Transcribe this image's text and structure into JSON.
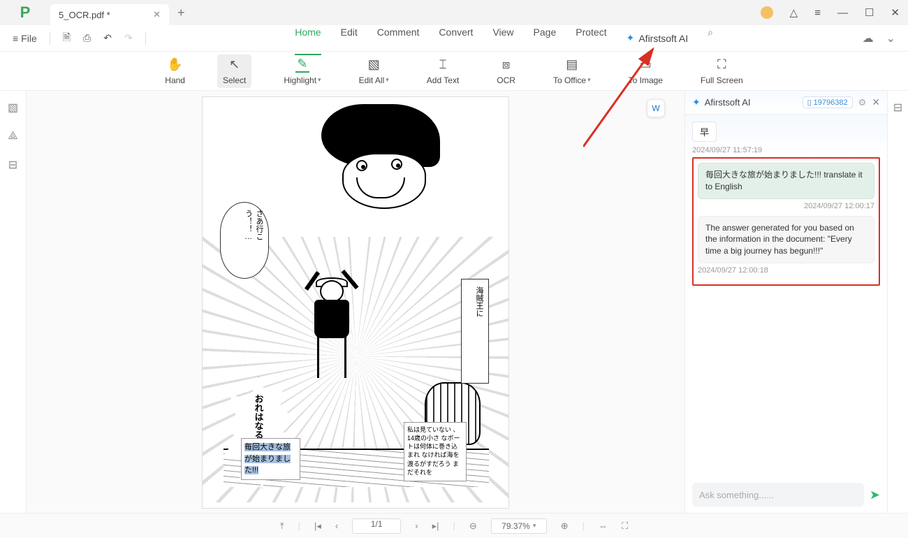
{
  "titlebar": {
    "tab_title": "5_OCR.pdf *"
  },
  "menubar": {
    "file_label": "File",
    "items": [
      "Home",
      "Edit",
      "Comment",
      "Convert",
      "View",
      "Page",
      "Protect"
    ],
    "active": "Home",
    "ai_label": "Afirstsoft AI"
  },
  "toolbar": {
    "hand": "Hand",
    "select": "Select",
    "highlight": "Highlight",
    "edit_all": "Edit All",
    "add_text": "Add Text",
    "ocr": "OCR",
    "to_office": "To Office",
    "to_image": "To Image",
    "full_screen": "Full Screen"
  },
  "document": {
    "bubble_left": "さあ行こう！！…",
    "bubble_right": "海賊王に",
    "jagged": "おれはなる!!!",
    "highlighted_box": "毎回大きな旅が始まりました!!!",
    "small_box": "私は見ていない 、\n14歳の小さ なボートは何体に巻き込まれ なければ海を 渡るがすだろう まだそれを"
  },
  "ai_panel": {
    "title": "Afirstsoft AI",
    "session_id": "19796382",
    "early_msg": "早",
    "early_ts": "2024/09/27 11:57:19",
    "user_msg": "毎回大きな旅が始まりました!!!  translate it to English",
    "user_ts": "2024/09/27 12:00:17",
    "ai_msg": "The answer generated for you based on the information in the document:\n\"Every time a big journey has begun!!!\"",
    "ai_ts": "2024/09/27 12:00:18",
    "placeholder": "Ask something......"
  },
  "statusbar": {
    "page": "1/1",
    "zoom": "79.37%"
  }
}
